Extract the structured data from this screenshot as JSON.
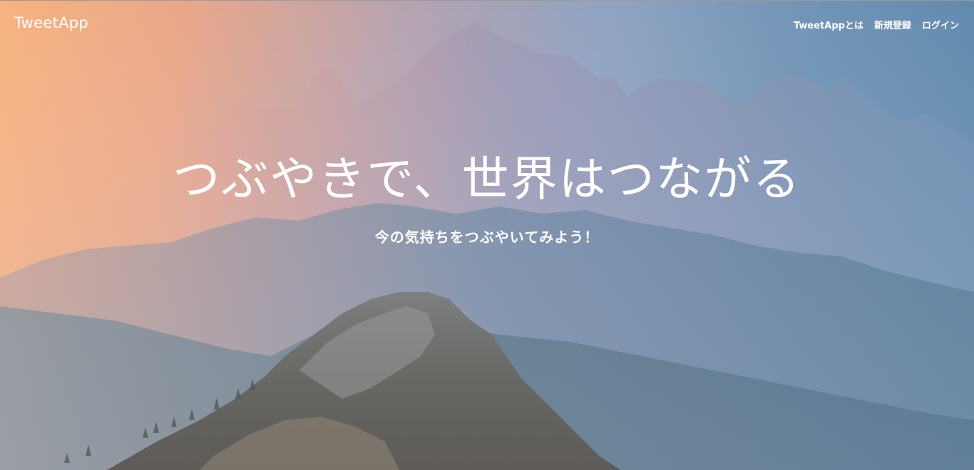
{
  "header": {
    "logo": "TweetApp",
    "nav": [
      {
        "label": "TweetAppとは"
      },
      {
        "label": "新規登録"
      },
      {
        "label": "ログイン"
      }
    ]
  },
  "hero": {
    "title": "つぶやきで、世界はつながる",
    "subtitle": "今の気持ちをつぶやいてみよう！",
    "background_image": "mountain-ridge-sunrise"
  },
  "colors": {
    "text": "#ffffff",
    "sky_warm": "#f7b27f",
    "sky_cool": "#6f93b5"
  }
}
